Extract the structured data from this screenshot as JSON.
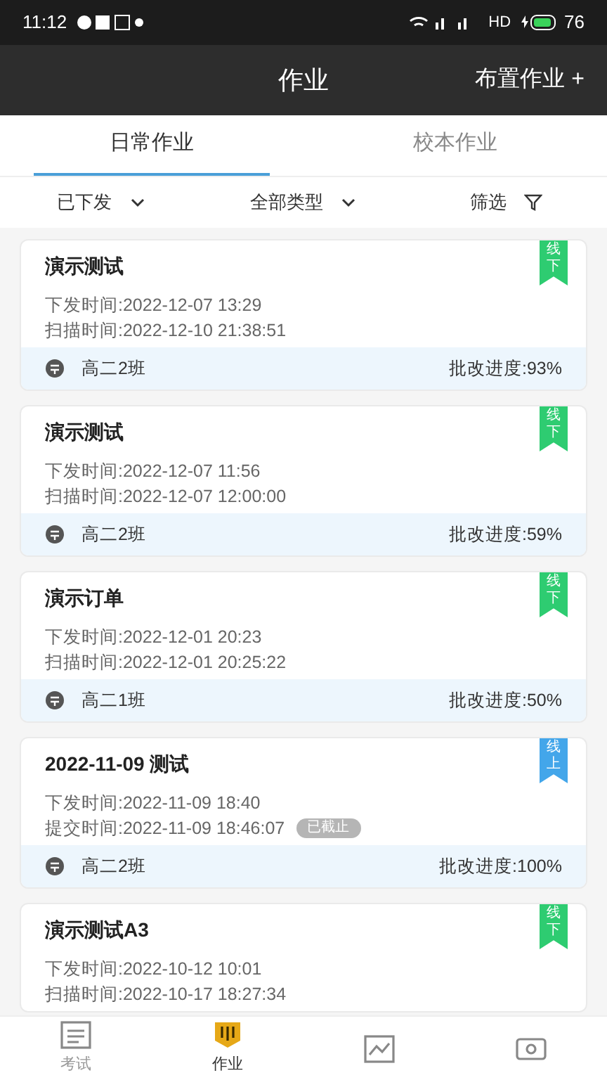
{
  "status_bar": {
    "time": "11:12",
    "network": "HD",
    "battery": "76"
  },
  "header": {
    "title": "作业",
    "action": "布置作业 +"
  },
  "tabs": [
    {
      "label": "日常作业",
      "selected": true
    },
    {
      "label": "校本作业",
      "selected": false
    }
  ],
  "filters": [
    {
      "label": "已下发",
      "kind": "dropdown"
    },
    {
      "label": "全部类型",
      "kind": "dropdown"
    },
    {
      "label": "筛选",
      "kind": "filter"
    }
  ],
  "cards": [
    {
      "title": "演示测试",
      "tag": "线下",
      "color": "#2ecc71",
      "lines": [
        "下发时间:2022-12-07 13:29",
        "扫描时间:2022-12-10 21:38:51"
      ],
      "class": "高二2班",
      "progress": "批改进度:93%"
    },
    {
      "title": "演示测试",
      "tag": "线下",
      "color": "#2ecc71",
      "lines": [
        "下发时间:2022-12-07 11:56",
        "扫描时间:2022-12-07 12:00:00"
      ],
      "class": "高二2班",
      "progress": "批改进度:59%"
    },
    {
      "title": "演示订单",
      "tag": "线下",
      "color": "#2ecc71",
      "lines": [
        "下发时间:2022-12-01 20:23",
        "扫描时间:2022-12-01 20:25:22"
      ],
      "class": "高二1班",
      "progress": "批改进度:50%"
    },
    {
      "title": "2022-11-09 测试",
      "tag": "线上",
      "color": "#43a6ea",
      "lines": [
        "下发时间:2022-11-09 18:40",
        "提交时间:2022-11-09 18:46:07"
      ],
      "badge": "已截止",
      "class": "高二2班",
      "progress": "批改进度:100%"
    },
    {
      "title": "演示测试A3",
      "tag": "线下",
      "color": "#2ecc71",
      "lines": [
        "下发时间:2022-10-12 10:01",
        "扫描时间:2022-10-17 18:27:34"
      ]
    }
  ],
  "bottom_nav": [
    {
      "label": "考试",
      "kind": "exam",
      "selected": false
    },
    {
      "label": "作业",
      "kind": "homework",
      "selected": true
    },
    {
      "kind": "chart",
      "selected": false
    },
    {
      "kind": "profile",
      "selected": false
    }
  ]
}
